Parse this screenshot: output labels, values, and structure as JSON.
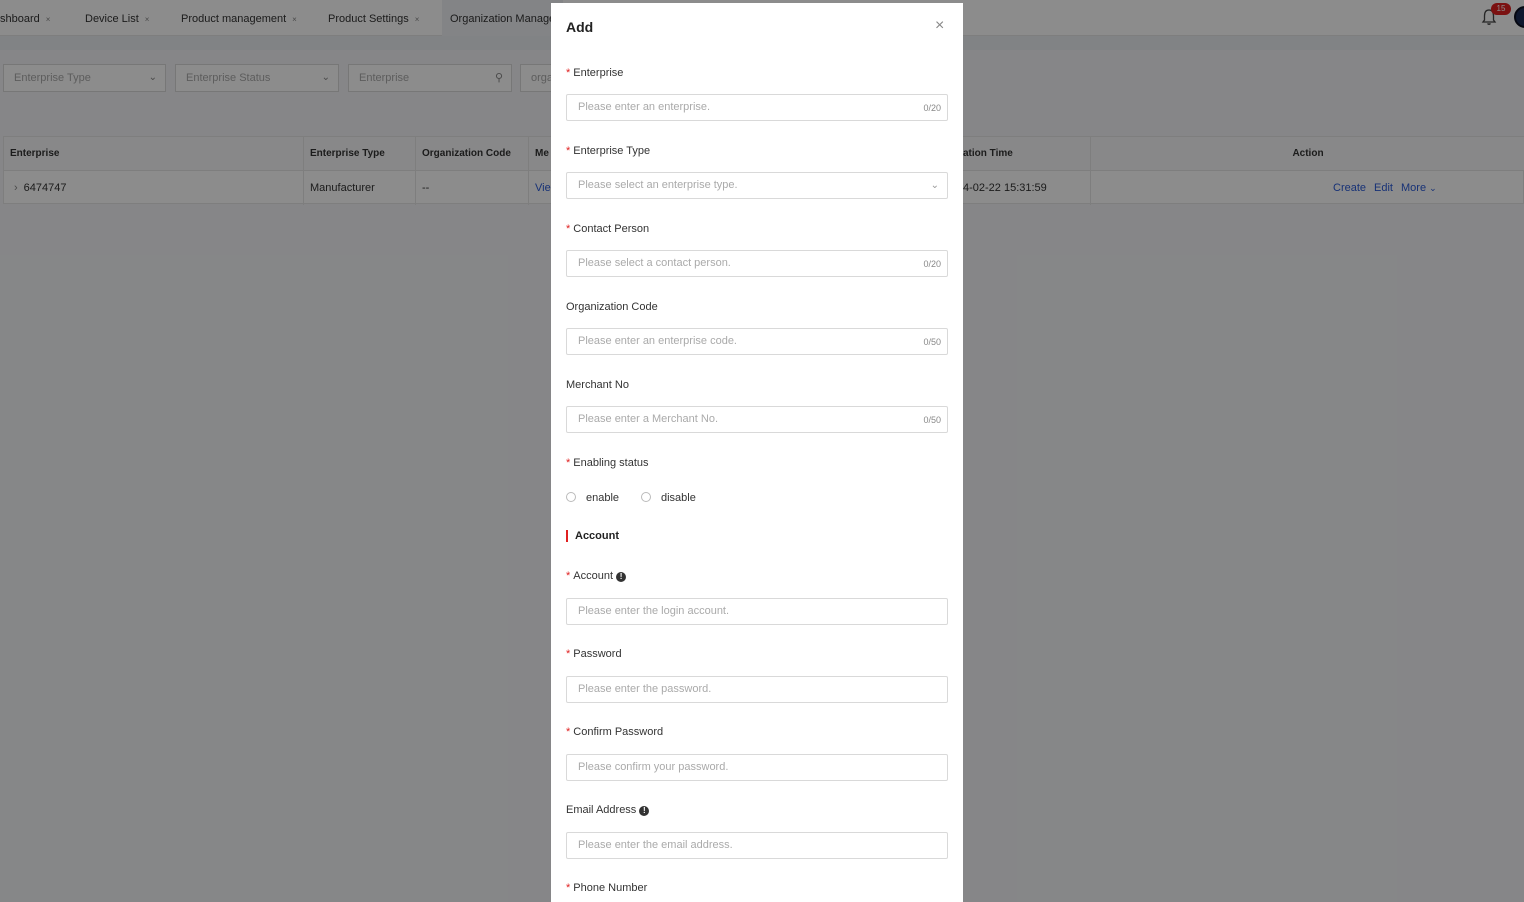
{
  "tabs": [
    {
      "label": "shboard",
      "close": "×"
    },
    {
      "label": "Device List",
      "close": "×"
    },
    {
      "label": "Product management",
      "close": "×"
    },
    {
      "label": "Product Settings",
      "close": "×"
    },
    {
      "label": "Organization Manage",
      "close": ""
    }
  ],
  "notifications": {
    "count": "15"
  },
  "filters": {
    "enterprise_type": "Enterprise Type",
    "enterprise_status": "Enterprise Status",
    "enterprise": "Enterprise",
    "org": "orga"
  },
  "table": {
    "headers": [
      "Enterprise",
      "Enterprise Type",
      "Organization Code",
      "Me",
      "ation Time",
      "Action"
    ],
    "row": {
      "enterprise": "6474747",
      "type": "Manufacturer",
      "code": "--",
      "view": "Vie",
      "time": "4-02-22 15:31:59",
      "actions": [
        "Create",
        "Edit",
        "More"
      ]
    }
  },
  "modal": {
    "title": "Add",
    "close": "×",
    "fields": {
      "enterprise": {
        "label": "Enterprise",
        "placeholder": "Please enter an enterprise.",
        "count": "0/20"
      },
      "enterprise_type": {
        "label": "Enterprise Type",
        "placeholder": "Please select an enterprise type."
      },
      "contact_person": {
        "label": "Contact Person",
        "placeholder": "Please select a contact person.",
        "count": "0/20"
      },
      "org_code": {
        "label": "Organization Code",
        "placeholder": "Please enter an enterprise code.",
        "count": "0/50"
      },
      "merchant_no": {
        "label": "Merchant No",
        "placeholder": "Please enter a Merchant No.",
        "count": "0/50"
      },
      "enabling_status": {
        "label": "Enabling status",
        "options": [
          "enable",
          "disable"
        ]
      },
      "account_section": "Account",
      "account": {
        "label": "Account",
        "placeholder": "Please enter the login account."
      },
      "password": {
        "label": "Password",
        "placeholder": "Please enter the password."
      },
      "confirm_password": {
        "label": "Confirm Password",
        "placeholder": "Please confirm your password."
      },
      "email": {
        "label": "Email Address",
        "placeholder": "Please enter the email address."
      },
      "phone": {
        "label": "Phone Number"
      }
    }
  }
}
